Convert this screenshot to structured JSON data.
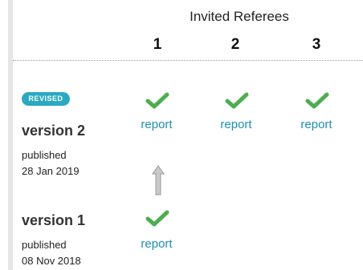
{
  "header": {
    "title": "Invited Referees",
    "columns": [
      "1",
      "2",
      "3"
    ]
  },
  "versions": [
    {
      "badge": "REVISED",
      "label": "version 2",
      "published_label": "published",
      "date": "28 Jan 2019",
      "reports": [
        "report",
        "report",
        "report"
      ]
    },
    {
      "label": "version 1",
      "published_label": "published",
      "date": "08 Nov 2018",
      "reports": [
        "report"
      ]
    }
  ],
  "colors": {
    "check": "#4cae4f",
    "link": "#1d8fb5",
    "badge": "#2aa9c2"
  },
  "icons": {
    "approved": "check-icon",
    "version_link": "up-arrow-icon"
  }
}
